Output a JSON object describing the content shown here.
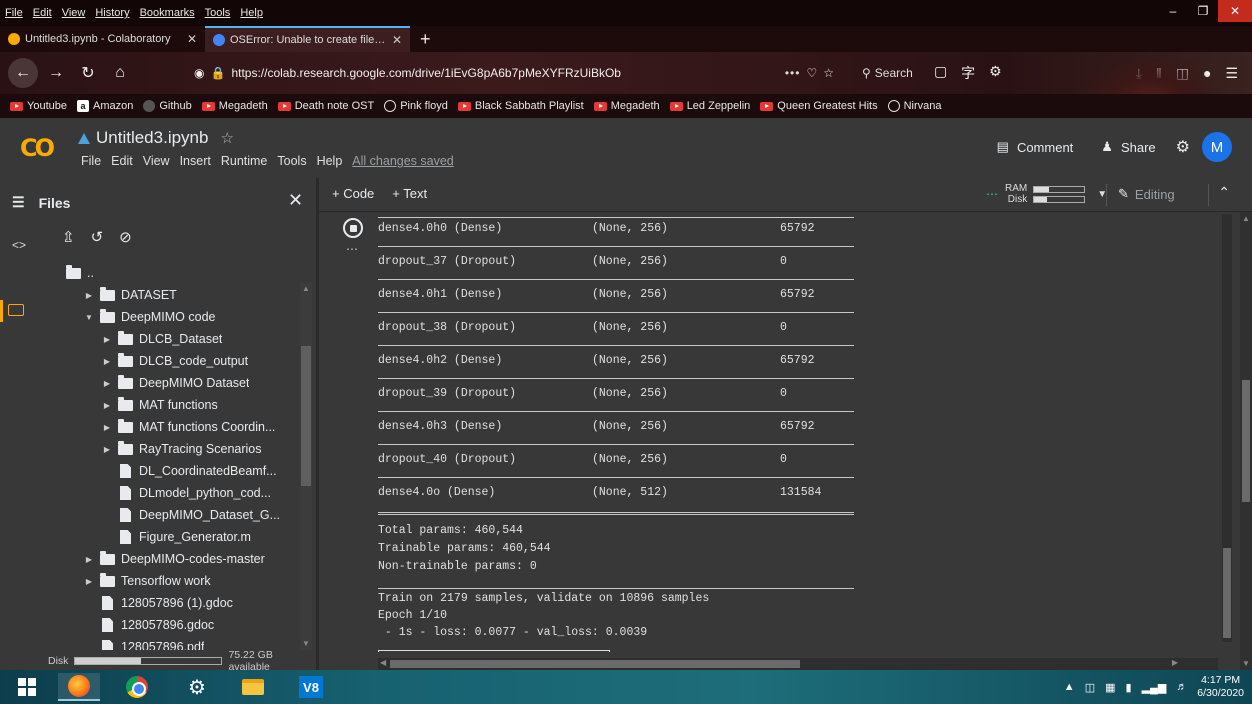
{
  "browser": {
    "menu": [
      "File",
      "Edit",
      "View",
      "History",
      "Bookmarks",
      "Tools",
      "Help"
    ],
    "tabs": [
      {
        "title": "Untitled3.ipynb - Colaboratory",
        "favicon_color": "#f9ab00",
        "active": true
      },
      {
        "title": "OSError: Unable to create file (u",
        "favicon_color": "#4285f4",
        "active": false
      }
    ],
    "url": "https://colab.research.google.com/drive/1iEvG8pA6b7pMeXYFRzUiBkOb",
    "more_label": "•••",
    "search_placeholder": "Search",
    "bookmarks": [
      {
        "label": "Youtube",
        "icon": "youtube-icon"
      },
      {
        "label": "Amazon",
        "icon": "amazon-icon"
      },
      {
        "label": "Github",
        "icon": "github-icon"
      },
      {
        "label": "Megadeth",
        "icon": "youtube-icon"
      },
      {
        "label": "Death note OST",
        "icon": "youtube-icon"
      },
      {
        "label": "Pink floyd",
        "icon": "globe-icon"
      },
      {
        "label": "Black Sabbath Playlist",
        "icon": "youtube-icon"
      },
      {
        "label": "Megadeth",
        "icon": "youtube-icon"
      },
      {
        "label": "Led Zeppelin",
        "icon": "youtube-icon"
      },
      {
        "label": "Queen Greatest Hits",
        "icon": "youtube-icon"
      },
      {
        "label": "Nirvana",
        "icon": "globe-icon"
      }
    ]
  },
  "colab": {
    "logo": "CO",
    "notebook_title": "Untitled3.ipynb",
    "menu": [
      "File",
      "Edit",
      "View",
      "Insert",
      "Runtime",
      "Tools",
      "Help"
    ],
    "save_status": "All changes saved",
    "comment_label": "Comment",
    "share_label": "Share",
    "avatar_letter": "M",
    "add_code_label": "+ Code",
    "add_text_label": "+ Text",
    "ram_label": "RAM",
    "disk_label": "Disk",
    "ram_usage": 0.3,
    "disk_usage": 0.25,
    "editing_label": "Editing",
    "accent": "#f9ab00"
  },
  "sidebar": {
    "title": "Files",
    "parent_label": "..",
    "tree": [
      {
        "label": "DATASET",
        "type": "folder",
        "depth": 0,
        "arrow": "▶"
      },
      {
        "label": "DeepMIMO code",
        "type": "folder",
        "depth": 0,
        "arrow": "▼"
      },
      {
        "label": "DLCB_Dataset",
        "type": "folder",
        "depth": 1,
        "arrow": "▶"
      },
      {
        "label": "DLCB_code_output",
        "type": "folder",
        "depth": 1,
        "arrow": "▶"
      },
      {
        "label": "DeepMIMO Dataset",
        "type": "folder",
        "depth": 1,
        "arrow": "▶"
      },
      {
        "label": "MAT functions",
        "type": "folder",
        "depth": 1,
        "arrow": "▶"
      },
      {
        "label": "MAT functions Coordin...",
        "type": "folder",
        "depth": 1,
        "arrow": "▶"
      },
      {
        "label": "RayTracing Scenarios",
        "type": "folder",
        "depth": 1,
        "arrow": "▶"
      },
      {
        "label": "DL_CoordinatedBeamf...",
        "type": "file",
        "depth": 1,
        "arrow": ""
      },
      {
        "label": "DLmodel_python_cod...",
        "type": "file",
        "depth": 1,
        "arrow": ""
      },
      {
        "label": "DeepMIMO_Dataset_G...",
        "type": "file",
        "depth": 1,
        "arrow": ""
      },
      {
        "label": "Figure_Generator.m",
        "type": "file",
        "depth": 1,
        "arrow": ""
      },
      {
        "label": "DeepMIMO-codes-master",
        "type": "folder",
        "depth": 0,
        "arrow": "▶"
      },
      {
        "label": "Tensorflow work",
        "type": "folder",
        "depth": 0,
        "arrow": "▶"
      },
      {
        "label": "128057896 (1).gdoc",
        "type": "file",
        "depth": 0,
        "arrow": ""
      },
      {
        "label": "128057896.gdoc",
        "type": "file",
        "depth": 0,
        "arrow": ""
      },
      {
        "label": "128057896.pdf",
        "type": "file",
        "depth": 0,
        "arrow": ""
      }
    ],
    "disk_label": "Disk",
    "disk_available": "75.22 GB available",
    "disk_usage": 0.45
  },
  "output": {
    "layers": [
      {
        "name": "dense4.0h0 (Dense)",
        "shape": "(None, 256)",
        "params": "65792"
      },
      {
        "name": "dropout_37 (Dropout)",
        "shape": "(None, 256)",
        "params": "0"
      },
      {
        "name": "dense4.0h1 (Dense)",
        "shape": "(None, 256)",
        "params": "65792"
      },
      {
        "name": "dropout_38 (Dropout)",
        "shape": "(None, 256)",
        "params": "0"
      },
      {
        "name": "dense4.0h2 (Dense)",
        "shape": "(None, 256)",
        "params": "65792"
      },
      {
        "name": "dropout_39 (Dropout)",
        "shape": "(None, 256)",
        "params": "0"
      },
      {
        "name": "dense4.0h3 (Dense)",
        "shape": "(None, 256)",
        "params": "65792"
      },
      {
        "name": "dropout_40 (Dropout)",
        "shape": "(None, 256)",
        "params": "0"
      },
      {
        "name": "dense4.0o (Dense)",
        "shape": "(None, 512)",
        "params": "131584"
      }
    ],
    "total_params": "Total params: 460,544",
    "trainable_params": "Trainable params: 460,544",
    "non_trainable_params": "Non-trainable params: 0",
    "train_info": "Train on 2179 samples, validate on 10896 samples",
    "epoch": "Epoch 1/10",
    "epoch_result": " - 1s - loss: 0.0077 - val_loss: 0.0039"
  },
  "taskbar": {
    "apps": [
      "windows-start",
      "firefox",
      "chrome",
      "settings",
      "file-explorer",
      "visual-studio"
    ],
    "vs_label": "V8",
    "time": "4:17 PM",
    "date": "6/30/2020"
  }
}
